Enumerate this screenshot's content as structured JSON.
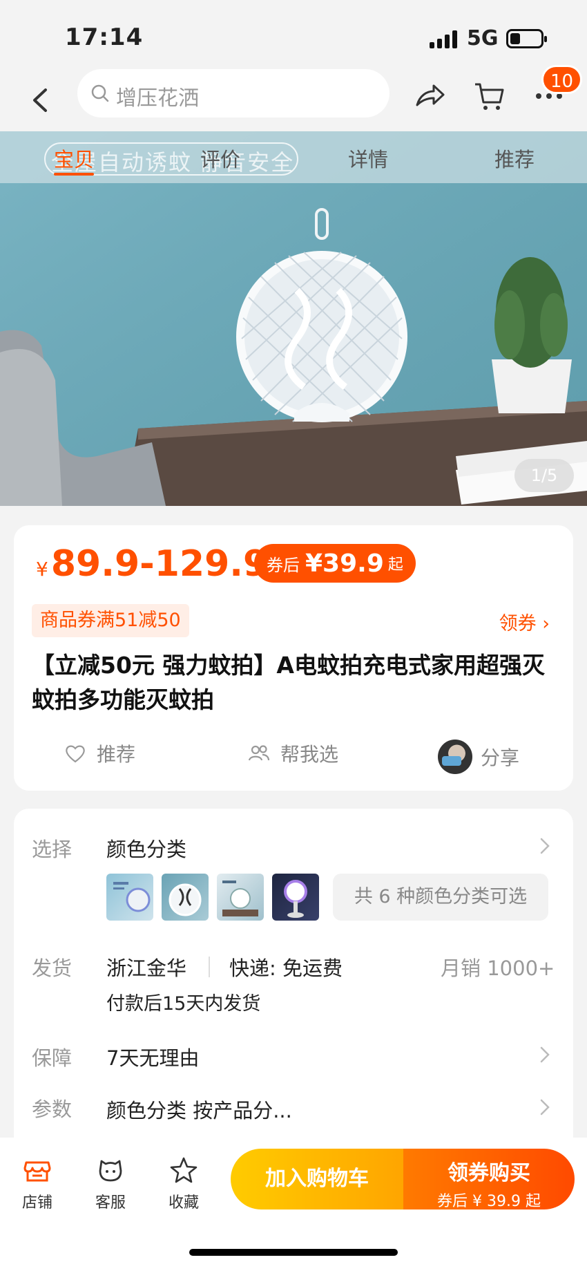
{
  "status_bar": {
    "time": "17:14",
    "network": "5G"
  },
  "top_nav": {
    "search_placeholder": "增压花洒",
    "cart_badge": "10"
  },
  "hero": {
    "tabs": [
      "宝贝",
      "评价",
      "详情",
      "推荐"
    ],
    "overlay_text": "全屋自动诱蚊 静音安全",
    "page_indicator": "1/5"
  },
  "price": {
    "currency": "¥",
    "range": "89.9-129.9",
    "after_label": "券后",
    "after_value": "¥39.9",
    "after_suffix": "起"
  },
  "coupon": {
    "text": "商品券满51减50",
    "get_label": "领券 ›"
  },
  "title": "【立减50元 强力蚊拍】A电蚊拍充电式家用超强灭蚊拍多功能灭蚊拍",
  "actions": {
    "recommend": "推荐",
    "help_choose": "帮我选",
    "share": "分享"
  },
  "details": {
    "select_label": "选择",
    "select_value": "颜色分类",
    "variants_more": "共 6 种颜色分类可选",
    "ship_label": "发货",
    "ship_origin": "浙江金华",
    "ship_express": "快递: 免运费",
    "monthly_sales": "月销  1000+",
    "ship_time": "付款后15天内发货",
    "guarantee_label": "保障",
    "guarantee_value": "7天无理由",
    "params_label": "参数",
    "params_value": "颜色分类 按产品分..."
  },
  "bottom_bar": {
    "store": "店铺",
    "service": "客服",
    "favorite": "收藏",
    "add_cart": "加入购物车",
    "buy_main": "领券购买",
    "buy_sub": "券后 ¥ 39.9 起"
  },
  "colors": {
    "accent": "#ff5000",
    "cart_btn": "#ffb300",
    "buy_btn": "#ff5a00"
  }
}
